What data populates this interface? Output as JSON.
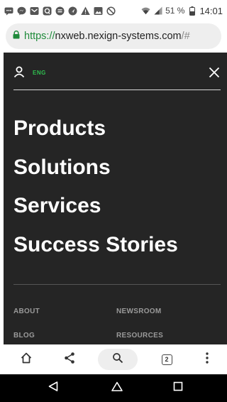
{
  "status_bar": {
    "notification_icons": [
      "chat-icon",
      "messenger-icon",
      "mail-icon",
      "app-icon",
      "message-icon",
      "navigation-icon",
      "warning-icon",
      "image-icon",
      "blocked-icon"
    ],
    "battery_percent": "51 %",
    "time": "14:01"
  },
  "url_bar": {
    "scheme": "https://",
    "host": "nxweb.nexign-systems.com",
    "path": "/#"
  },
  "menu": {
    "language": "ENG",
    "items": [
      "Products",
      "Solutions",
      "Services",
      "Success Stories"
    ],
    "links": {
      "about": "ABOUT",
      "newsroom": "NEWSROOM",
      "blog": "BLOG",
      "resources": "RESOURCES"
    }
  },
  "toolbar": {
    "tab_count": "2"
  },
  "colors": {
    "menu_background": "#252525",
    "accent_green": "#2fbf4f"
  }
}
